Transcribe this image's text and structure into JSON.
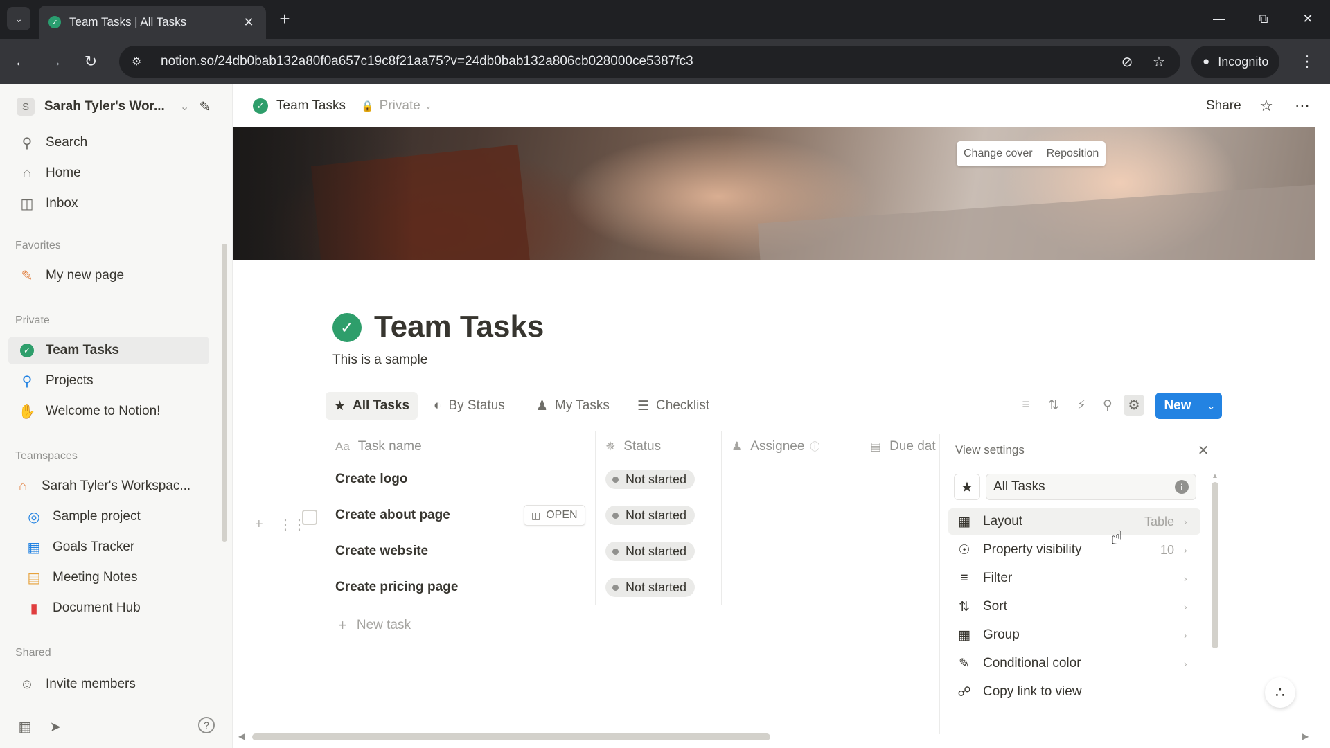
{
  "browser": {
    "tab_title": "Team Tasks | All Tasks",
    "url": "notion.so/24db0bab132a80f0a657c19c8f21aa75?v=24db0bab132a806cb028000ce5387fc3",
    "incognito_label": "Incognito"
  },
  "sidebar": {
    "workspace_initial": "S",
    "workspace_name": "Sarah Tyler's Wor...",
    "top_items": [
      {
        "icon": "search-icon",
        "label": "Search"
      },
      {
        "icon": "home-icon",
        "label": "Home"
      },
      {
        "icon": "inbox-icon",
        "label": "Inbox"
      }
    ],
    "favorites_label": "Favorites",
    "favorites": [
      {
        "icon": "pencil-icon",
        "label": "My new page"
      }
    ],
    "private_label": "Private",
    "private_items": [
      {
        "icon": "check-circle-icon",
        "label": "Team Tasks",
        "active": true
      },
      {
        "icon": "projects-icon",
        "label": "Projects"
      },
      {
        "icon": "wave-hand-icon",
        "label": "Welcome to Notion!"
      }
    ],
    "teamspaces_label": "Teamspaces",
    "teamspace_name": "Sarah Tyler's Workspac...",
    "teamspace_items": [
      {
        "icon": "target-icon",
        "label": "Sample project"
      },
      {
        "icon": "chart-icon",
        "label": "Goals Tracker"
      },
      {
        "icon": "calendar-icon",
        "label": "Meeting Notes"
      },
      {
        "icon": "document-icon",
        "label": "Document Hub"
      }
    ],
    "shared_label": "Shared",
    "invite_label": "Invite members"
  },
  "topbar": {
    "breadcrumb_title": "Team Tasks",
    "privacy": "Private",
    "share_label": "Share"
  },
  "cover": {
    "change_cover": "Change cover",
    "reposition": "Reposition"
  },
  "page": {
    "title": "Team Tasks",
    "description": "This is a sample"
  },
  "views": [
    {
      "icon": "star-icon",
      "label": "All Tasks",
      "active": true
    },
    {
      "icon": "status-icon",
      "label": "By Status"
    },
    {
      "icon": "person-icon",
      "label": "My Tasks"
    },
    {
      "icon": "checklist-icon",
      "label": "Checklist"
    }
  ],
  "new_button_label": "New",
  "table": {
    "columns": [
      {
        "icon": "Aa",
        "label": "Task name"
      },
      {
        "icon": "status-icon",
        "label": "Status"
      },
      {
        "icon": "people-icon",
        "label": "Assignee"
      },
      {
        "icon": "calendar-icon",
        "label": "Due dat"
      }
    ],
    "rows": [
      {
        "name": "Create logo",
        "status": "Not started"
      },
      {
        "name": "Create about page",
        "status": "Not started"
      },
      {
        "name": "Create website",
        "status": "Not started"
      },
      {
        "name": "Create pricing page",
        "status": "Not started"
      }
    ],
    "open_label": "OPEN",
    "new_task_label": "New task"
  },
  "view_settings": {
    "title": "View settings",
    "view_name": "All Tasks",
    "items": [
      {
        "icon": "table-icon",
        "label": "Layout",
        "value": "Table"
      },
      {
        "icon": "eye-icon",
        "label": "Property visibility",
        "value": "10"
      },
      {
        "icon": "filter-icon",
        "label": "Filter",
        "value": ""
      },
      {
        "icon": "sort-icon",
        "label": "Sort",
        "value": ""
      },
      {
        "icon": "group-icon",
        "label": "Group",
        "value": ""
      },
      {
        "icon": "paint-icon",
        "label": "Conditional color",
        "value": ""
      },
      {
        "icon": "link-icon",
        "label": "Copy link to view",
        "value": ""
      }
    ]
  },
  "colors": {
    "accent_blue": "#2383e2",
    "check_green": "#2e9e6b",
    "sidebar_bg": "#f7f7f5"
  }
}
